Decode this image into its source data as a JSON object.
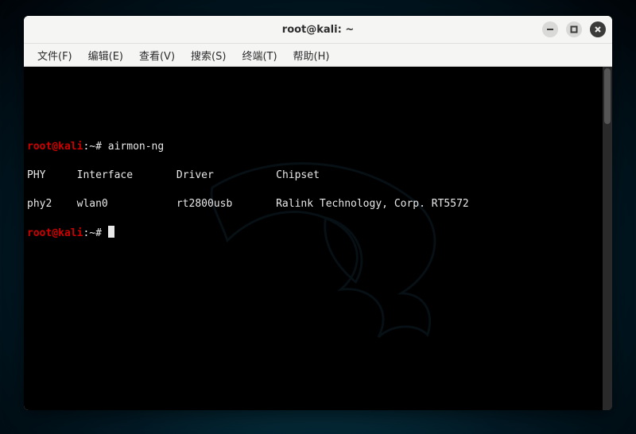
{
  "window": {
    "title": "root@kali: ~"
  },
  "menu": {
    "file": "文件(F)",
    "edit": "编辑(E)",
    "view": "查看(V)",
    "search": "搜索(S)",
    "terminal": "终端(T)",
    "help": "帮助(H)"
  },
  "prompt": {
    "user_host": "root@kali",
    "sep": ":",
    "path": "~",
    "symbol": "#"
  },
  "terminal": {
    "command": "airmon-ng",
    "headers": {
      "phy": "PHY",
      "iface": "Interface",
      "driver": "Driver",
      "chipset": "Chipset"
    },
    "row": {
      "phy": "phy2",
      "iface": "wlan0",
      "driver": "rt2800usb",
      "chipset": "Ralink Technology, Corp. RT5572"
    }
  },
  "icons": {
    "minimize": "minimize",
    "maximize": "maximize",
    "close": "close"
  }
}
